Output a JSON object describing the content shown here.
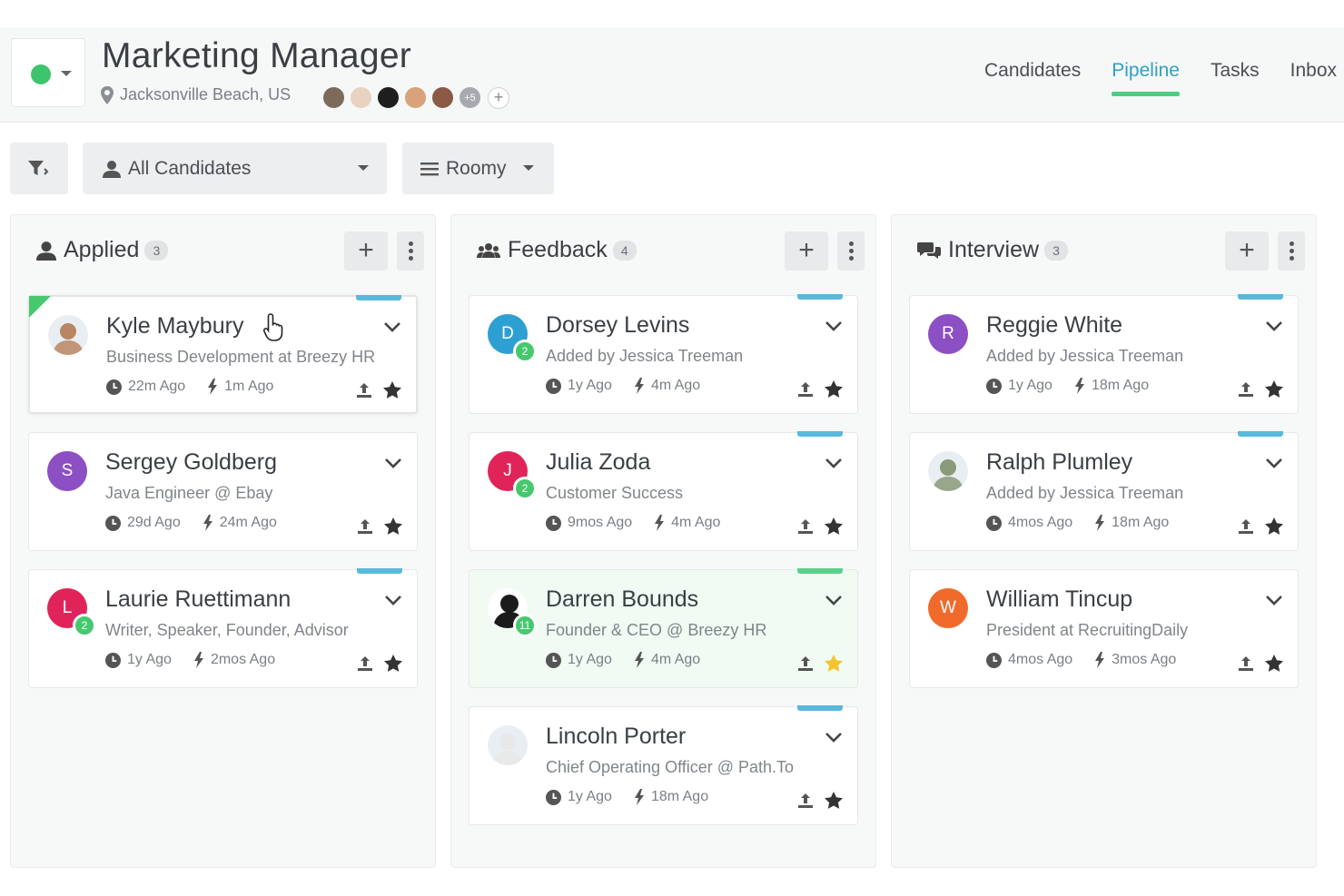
{
  "header": {
    "job_title": "Marketing Manager",
    "location": "Jacksonville Beach, US",
    "team_more": "+5",
    "team_add": "+",
    "status_color": "#3ec46d",
    "nav": [
      "Candidates",
      "Pipeline",
      "Tasks",
      "Inbox"
    ],
    "active_tab": "Pipeline"
  },
  "toolbar": {
    "candidates_filter": "All Candidates",
    "view_mode": "Roomy"
  },
  "colors": {
    "accent_blue": "#2ea1c6",
    "accent_green": "#47c86f",
    "tag_blue": "#5ab8dd",
    "tag_green": "#5bd08a",
    "star_gold": "#f4c430"
  },
  "columns": [
    {
      "title": "Applied",
      "count": "3",
      "icon": "user-icon",
      "cards": [
        {
          "name": "Kyle Maybury",
          "subtitle": "Business Development at Breezy HR",
          "time1": "22m Ago",
          "time2": "1m Ago",
          "avatar_type": "photo",
          "avatar_letter": "",
          "avatar_color": "#b98563",
          "badge": "",
          "tag": "blue",
          "starred": false
        },
        {
          "name": "Sergey Goldberg",
          "subtitle": "Java Engineer @ Ebay",
          "time1": "29d Ago",
          "time2": "24m Ago",
          "avatar_type": "letter",
          "avatar_letter": "S",
          "avatar_color": "#8c4fc4",
          "badge": "",
          "tag": "",
          "starred": false
        },
        {
          "name": "Laurie Ruettimann",
          "subtitle": "Writer, Speaker, Founder, Advisor",
          "time1": "1y Ago",
          "time2": "2mos Ago",
          "avatar_type": "letter",
          "avatar_letter": "L",
          "avatar_color": "#e0245a",
          "badge": "2",
          "tag": "blue",
          "starred": false
        }
      ]
    },
    {
      "title": "Feedback",
      "count": "4",
      "icon": "team-icon",
      "cards": [
        {
          "name": "Dorsey Levins",
          "subtitle": "Added by Jessica Treeman",
          "time1": "1y Ago",
          "time2": "4m Ago",
          "avatar_type": "letter",
          "avatar_letter": "D",
          "avatar_color": "#2e9fd2",
          "badge": "2",
          "tag": "blue",
          "starred": false
        },
        {
          "name": "Julia Zoda",
          "subtitle": "Customer Success",
          "time1": "9mos Ago",
          "time2": "4m Ago",
          "avatar_type": "letter",
          "avatar_letter": "J",
          "avatar_color": "#e0245a",
          "badge": "2",
          "tag": "blue",
          "starred": false
        },
        {
          "name": "Darren Bounds",
          "subtitle": "Founder & CEO @ Breezy HR",
          "time1": "1y Ago",
          "time2": "4m Ago",
          "avatar_type": "silhouette",
          "avatar_letter": "",
          "avatar_color": "#222222",
          "badge": "11",
          "tag": "green",
          "starred": true
        },
        {
          "name": "Lincoln Porter",
          "subtitle": "Chief Operating Officer @ Path.To",
          "time1": "1y Ago",
          "time2": "18m Ago",
          "avatar_type": "photo",
          "avatar_letter": "",
          "avatar_color": "#e8e8e8",
          "badge": "",
          "tag": "blue",
          "starred": false
        }
      ]
    },
    {
      "title": "Interview",
      "count": "3",
      "icon": "chat-icon",
      "cards": [
        {
          "name": "Reggie White",
          "subtitle": "Added by Jessica Treeman",
          "time1": "1y Ago",
          "time2": "18m Ago",
          "avatar_type": "letter",
          "avatar_letter": "R",
          "avatar_color": "#8c4fc4",
          "badge": "",
          "tag": "blue",
          "starred": false
        },
        {
          "name": "Ralph Plumley",
          "subtitle": "Added by Jessica Treeman",
          "time1": "4mos Ago",
          "time2": "18m Ago",
          "avatar_type": "photo",
          "avatar_letter": "",
          "avatar_color": "#8a9a7a",
          "badge": "",
          "tag": "blue",
          "starred": false
        },
        {
          "name": "William Tincup",
          "subtitle": "President at RecruitingDaily",
          "time1": "4mos Ago",
          "time2": "3mos Ago",
          "avatar_type": "letter",
          "avatar_letter": "W",
          "avatar_color": "#f06a2c",
          "badge": "",
          "tag": "",
          "starred": false
        }
      ]
    }
  ]
}
